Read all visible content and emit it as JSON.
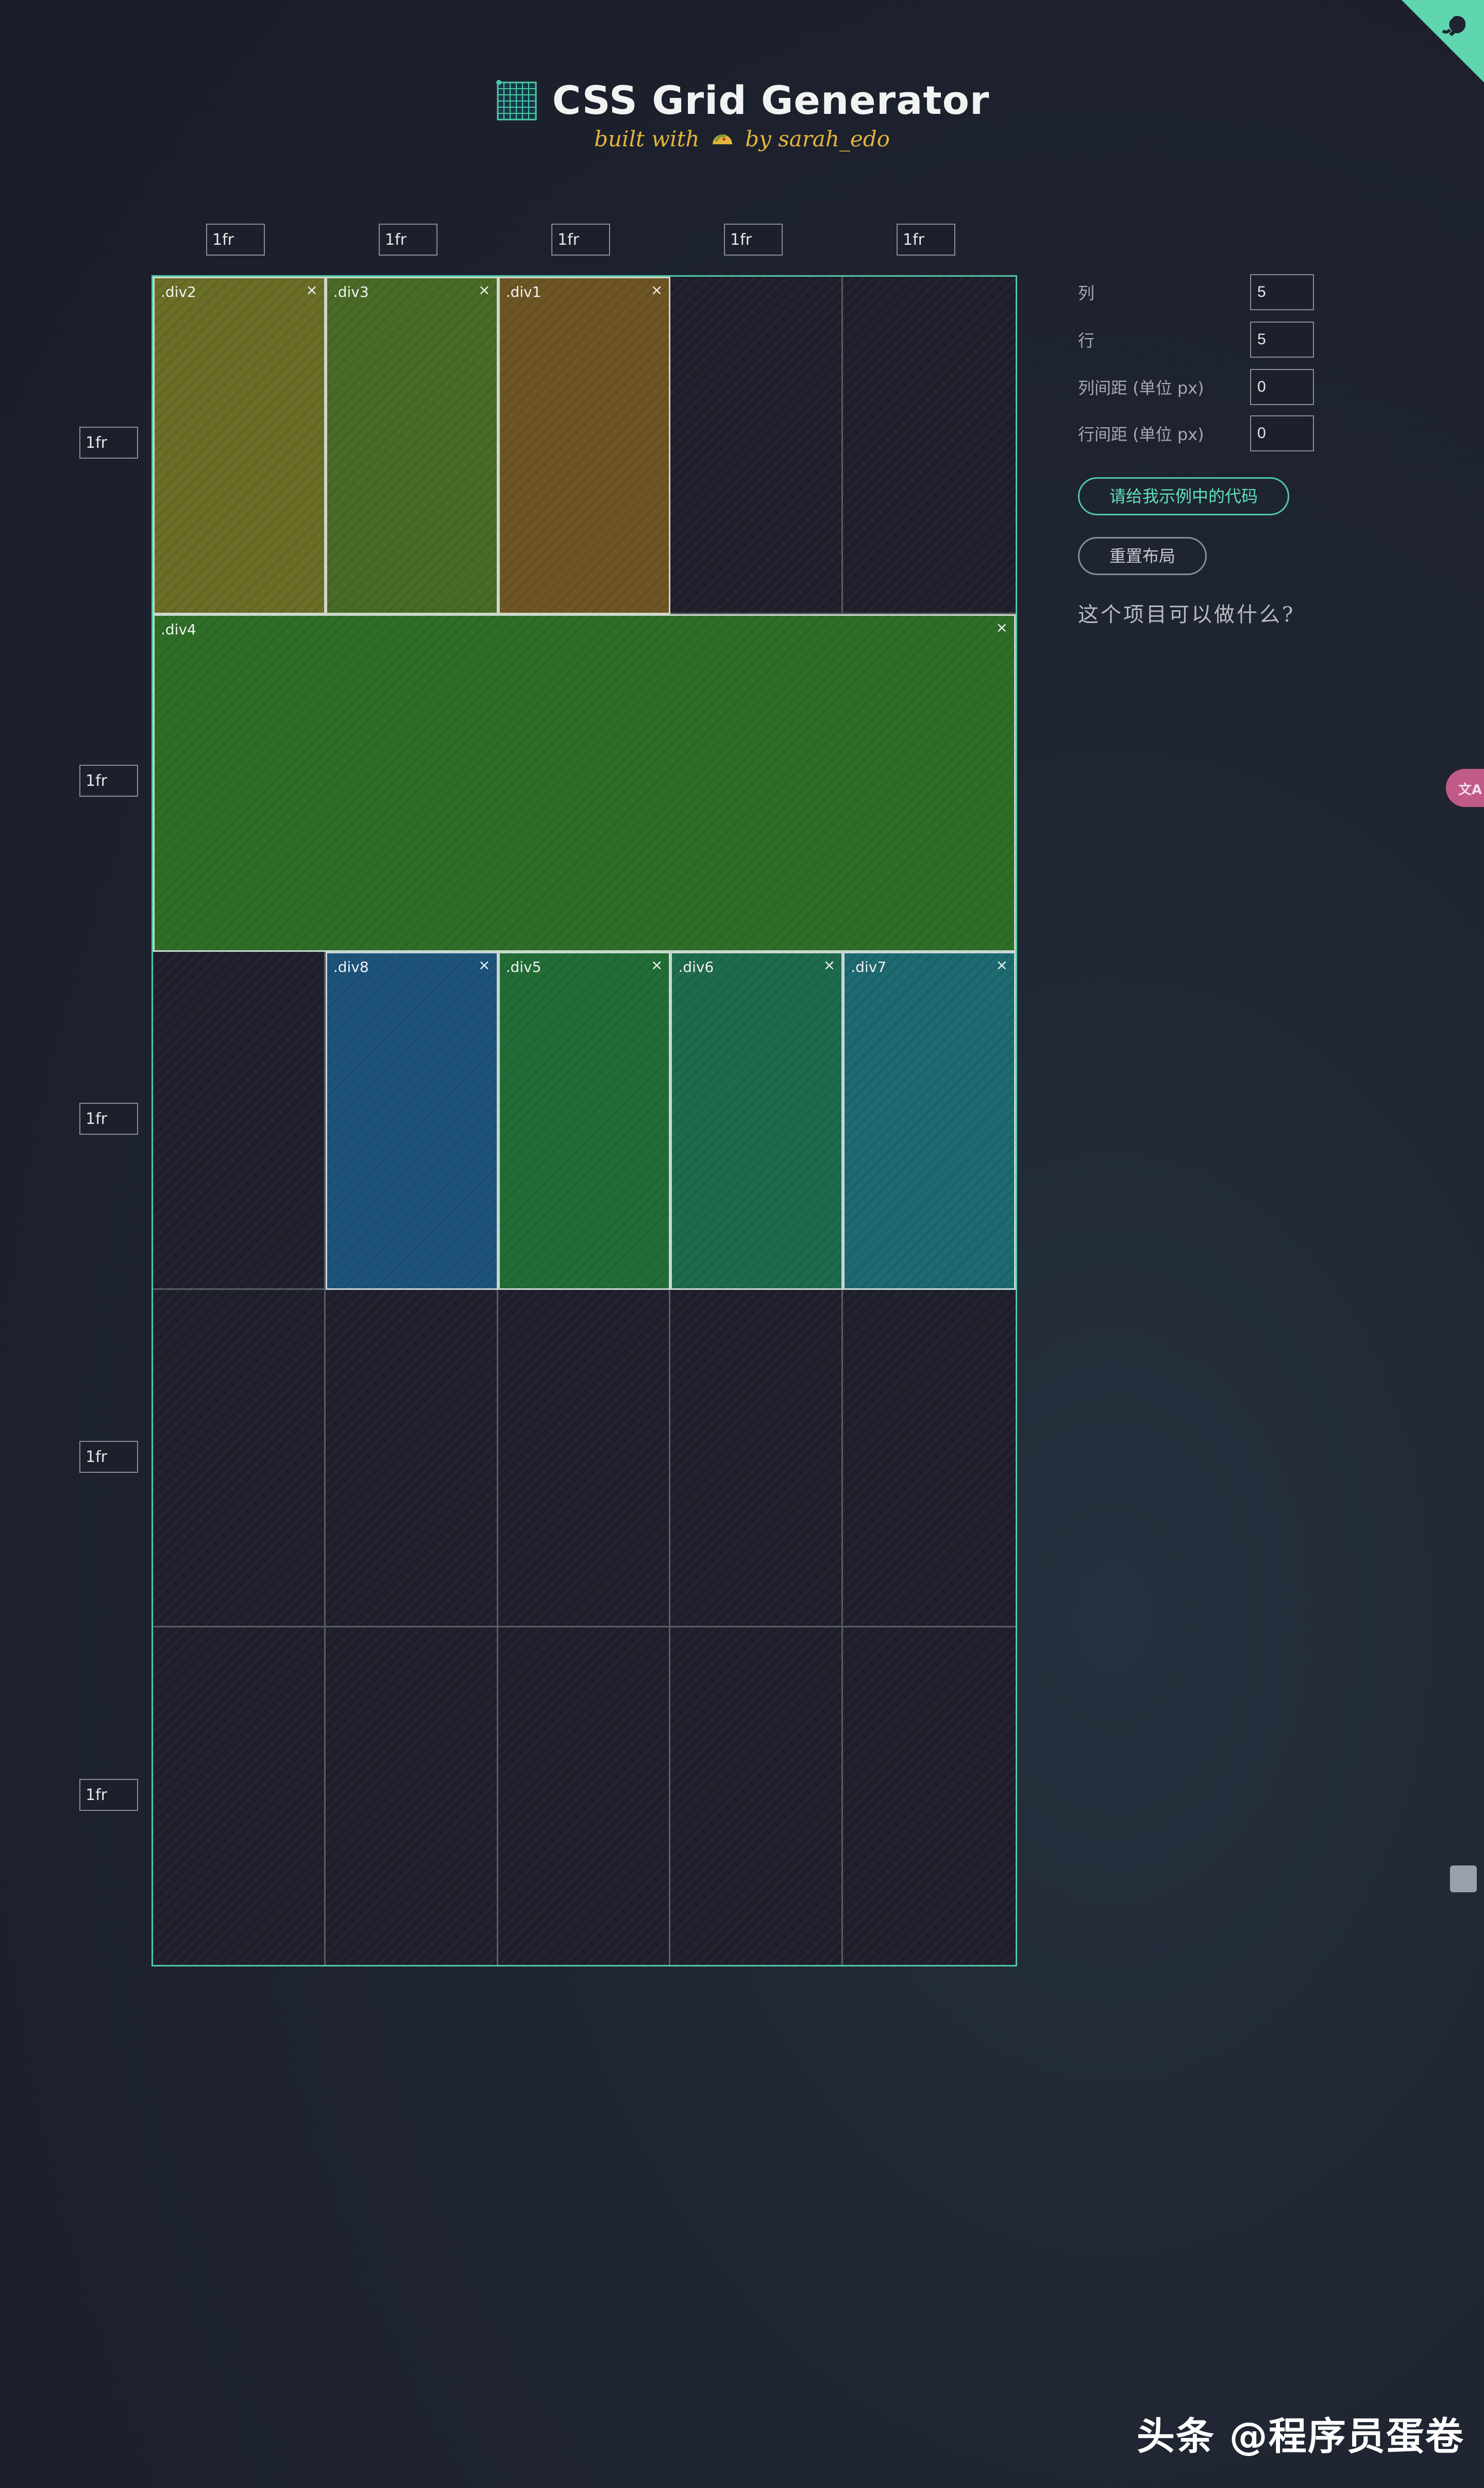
{
  "app": {
    "title": "CSS Grid Generator",
    "subtitle_prefix": "built with",
    "subtitle_suffix": "by sarah_edo"
  },
  "grid": {
    "columns": 5,
    "rows": 5,
    "column_tracks": [
      "1fr",
      "1fr",
      "1fr",
      "1fr",
      "1fr"
    ],
    "row_tracks": [
      "1fr",
      "1fr",
      "1fr",
      "1fr",
      "1fr"
    ],
    "border_color": "#4fc9a6",
    "items": [
      {
        "name": ".div2",
        "row_start": 1,
        "row_end": 2,
        "col_start": 1,
        "col_end": 2,
        "color": "#6a6e26",
        "close": "×"
      },
      {
        "name": ".div3",
        "row_start": 1,
        "row_end": 2,
        "col_start": 2,
        "col_end": 3,
        "color": "#496b26",
        "close": "×"
      },
      {
        "name": ".div1",
        "row_start": 1,
        "row_end": 2,
        "col_start": 3,
        "col_end": 4,
        "color": "#6d5524",
        "close": "×"
      },
      {
        "name": ".div4",
        "row_start": 2,
        "row_end": 3,
        "col_start": 1,
        "col_end": 6,
        "color": "#2f6e26",
        "close": "×"
      },
      {
        "name": ".div8",
        "row_start": 3,
        "row_end": 4,
        "col_start": 2,
        "col_end": 3,
        "color": "#1d537a",
        "close": "×"
      },
      {
        "name": ".div5",
        "row_start": 3,
        "row_end": 4,
        "col_start": 3,
        "col_end": 4,
        "color": "#226d35",
        "close": "×"
      },
      {
        "name": ".div6",
        "row_start": 3,
        "row_end": 4,
        "col_start": 4,
        "col_end": 5,
        "color": "#1f6b4e",
        "close": "×"
      },
      {
        "name": ".div7",
        "row_start": 3,
        "row_end": 4,
        "col_start": 5,
        "col_end": 6,
        "color": "#1d6a70",
        "close": "×"
      }
    ]
  },
  "controls": {
    "columns_label": "列",
    "columns_value": "5",
    "rows_label": "行",
    "rows_value": "5",
    "col_gap_label": "列间距 (单位 px)",
    "col_gap_value": "0",
    "row_gap_label": "行间距 (单位 px)",
    "row_gap_value": "0",
    "show_code_button": "请给我示例中的代码",
    "reset_button": "重置布局",
    "what_link": "这个项目可以做什么?"
  },
  "watermark": "头条 @程序员蛋卷",
  "colors": {
    "accent": "#4fc9a6",
    "subtitle": "#e3b43c",
    "side_tab": "#c05a86"
  },
  "icons": {
    "corner": "github-octocat-icon",
    "logo": "grid-logo-icon",
    "taco": "taco-icon",
    "side_tab": "translate-icon",
    "side_badge": "robot-icon"
  }
}
